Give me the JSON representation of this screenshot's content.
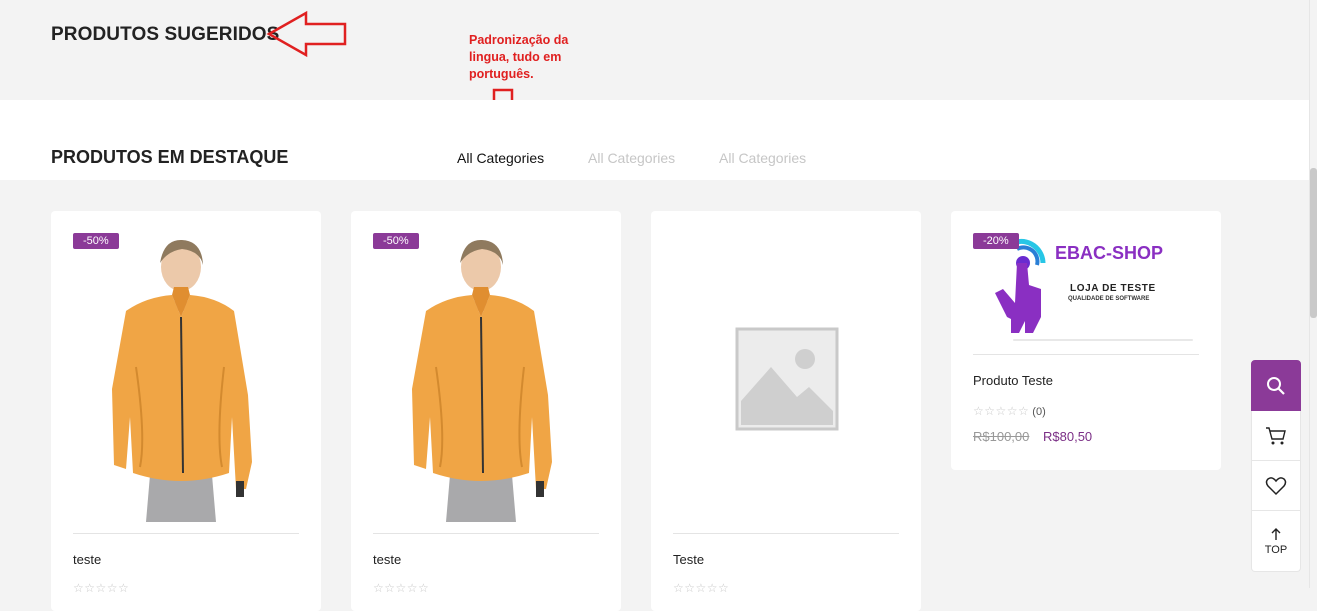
{
  "annotations": {
    "left_arrow": "arrow-left-annotation",
    "down_arrow": "arrow-down-annotation",
    "note_lines": [
      "Padronização da",
      "lingua, tudo em",
      "português."
    ],
    "color": "#e02020"
  },
  "suggested": {
    "title": "PRODUTOS SUGERIDOS"
  },
  "featured": {
    "title": "PRODUTOS EM DESTAQUE",
    "tabs": [
      "All Categories",
      "All Categories",
      "All Categories"
    ]
  },
  "products": [
    {
      "badge": "-50%",
      "name": "teste",
      "image": "orange-jacket-model"
    },
    {
      "badge": "-50%",
      "name": "teste",
      "image": "orange-jacket-model"
    },
    {
      "name": "Teste",
      "image": "placeholder-image"
    },
    {
      "badge": "-20%",
      "name": "Produto Teste",
      "image": "ebac-shop-logo",
      "logo": {
        "brand": "EBAC-SHOP",
        "line1": "LOJA DE TESTE",
        "line2": "QUALIDADE DE SOFTWARE"
      },
      "rating_count": "(0)",
      "price_old": "R$100,00",
      "price_new": "R$80,50"
    }
  ],
  "side_panel": {
    "top_label": "TOP",
    "icons": [
      "search-icon",
      "cart-icon",
      "heart-icon",
      "arrow-up-icon"
    ]
  },
  "colors": {
    "accent": "#8b3a98",
    "price": "#7b2f86",
    "background": "#f3f3f3"
  }
}
